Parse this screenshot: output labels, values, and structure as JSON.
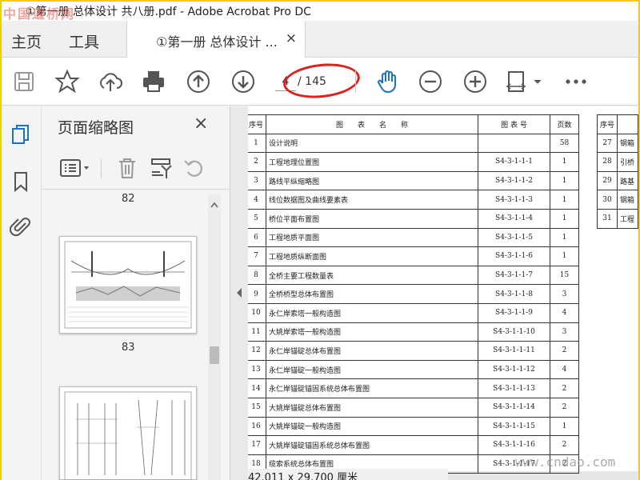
{
  "window": {
    "title": "①第一册 总体设计 共八册.pdf - Adobe Acrobat Pro DC",
    "watermark_tl": "中国道桥网"
  },
  "menu": {
    "home": "主页",
    "tools": "工具"
  },
  "tab": {
    "label": "①第一册 总体设计 ...",
    "close": "×"
  },
  "toolbar": {
    "page_current": "4",
    "page_total": "/ 145"
  },
  "panel": {
    "title": "页面缩略图",
    "close": "×",
    "page_numbers": [
      "82",
      "83"
    ]
  },
  "document": {
    "headers": {
      "no": "序号",
      "name": "图　　表　　名　　称",
      "code": "图 表 号",
      "pages": "页数",
      "no2": "序号"
    },
    "rows": [
      {
        "no": "1",
        "name": "设计说明",
        "code": "",
        "pages": "58"
      },
      {
        "no": "2",
        "name": "工程地理位置图",
        "code": "S4-3-1-1-1",
        "pages": "1"
      },
      {
        "no": "3",
        "name": "路线平纵缩略图",
        "code": "S4-3-1-1-2",
        "pages": "1"
      },
      {
        "no": "4",
        "name": "线位数据图及曲线要素表",
        "code": "S4-3-1-1-3",
        "pages": "1"
      },
      {
        "no": "5",
        "name": "桥位平面布置图",
        "code": "S4-3-1-1-4",
        "pages": "1"
      },
      {
        "no": "6",
        "name": "工程地质平面图",
        "code": "S4-3-1-1-5",
        "pages": "1"
      },
      {
        "no": "7",
        "name": "工程地质纵断面图",
        "code": "S4-3-1-1-6",
        "pages": "1"
      },
      {
        "no": "8",
        "name": "全桥主要工程数量表",
        "code": "S4-3-1-1-7",
        "pages": "15"
      },
      {
        "no": "9",
        "name": "全桥桥型总体布置图",
        "code": "S4-3-1-1-8",
        "pages": "3"
      },
      {
        "no": "10",
        "name": "永仁岸索塔一般构造图",
        "code": "S4-3-1-1-9",
        "pages": "4"
      },
      {
        "no": "11",
        "name": "大姚岸索塔一般构造图",
        "code": "S4-3-1-1-10",
        "pages": "3"
      },
      {
        "no": "12",
        "name": "永仁岸锚碇总体布置图",
        "code": "S4-3-1-1-11",
        "pages": "2"
      },
      {
        "no": "13",
        "name": "永仁岸锚碇一般构造图",
        "code": "S4-3-1-1-12",
        "pages": "4"
      },
      {
        "no": "14",
        "name": "永仁岸锚碇锚固系统总体布置图",
        "code": "S4-3-1-1-13",
        "pages": "2"
      },
      {
        "no": "15",
        "name": "大姚岸锚碇总体布置图",
        "code": "S4-3-1-1-14",
        "pages": "2"
      },
      {
        "no": "16",
        "name": "大姚岸锚碇一般构造图",
        "code": "S4-3-1-1-15",
        "pages": "1"
      },
      {
        "no": "17",
        "name": "大姚岸锚碇锚固系统总体布置图",
        "code": "S4-3-1-1-16",
        "pages": "2"
      },
      {
        "no": "18",
        "name": "缆索系统总体布置图",
        "code": "S4-3-1-1-17",
        "pages": "2"
      }
    ],
    "right_rows": [
      {
        "no": "27",
        "name": "钢箱"
      },
      {
        "no": "28",
        "name": "引桥"
      },
      {
        "no": "29",
        "name": "路基"
      },
      {
        "no": "30",
        "name": "钢箱"
      },
      {
        "no": "31",
        "name": "工程"
      }
    ]
  },
  "status": {
    "size": "42.011 x 29.700 厘米"
  },
  "watermark_br": "www.cndao.com",
  "colors": {
    "accent_blue": "#1a73c9",
    "oval_red": "#e0201c"
  }
}
